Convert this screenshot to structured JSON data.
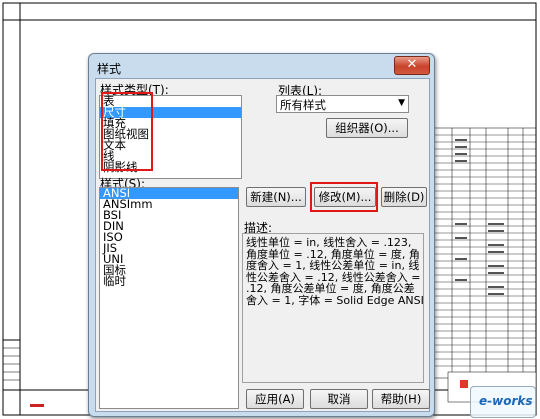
{
  "dialog": {
    "title": "样式",
    "close_glyph": "✕",
    "style_type_label": "样式类型(T):",
    "style_types": [
      "表",
      "尺寸",
      "填充",
      "图纸视图",
      "文本",
      "线",
      "阴影线"
    ],
    "selected_style_type": "尺寸",
    "list_label": "列表(L):",
    "list_value": "所有样式",
    "organizer_button": "组织器(O)...",
    "styles_label": "样式(S):",
    "styles": [
      "ANSI",
      "ANSImm",
      "BSI",
      "DIN",
      "ISO",
      "JIS",
      "UNI",
      "国标",
      "临时"
    ],
    "selected_style": "ANSI",
    "new_button": "新建(N)...",
    "modify_button": "修改(M)...",
    "delete_button": "删除(D)",
    "description_label": "描述:",
    "description": "线性单位 = in, 线性舍入 = .123, 角度单位 = .12, 角度单位 = 度, 角度舍入 = 1, 线性公差单位 = in, 线性公差舍入 = .12, 线性公差舍入 = .12, 角度公差单位 = 度, 角度公差舍入 = 1, 字体 = Solid Edge ANSI",
    "apply_button": "应用(A)",
    "cancel_button": "取消",
    "help_button": "帮助(H)"
  },
  "colors": {
    "highlight_box": "#e01818",
    "selection": "#3399ff",
    "dialog_frame": "#c9dced"
  },
  "watermark": "e-works"
}
